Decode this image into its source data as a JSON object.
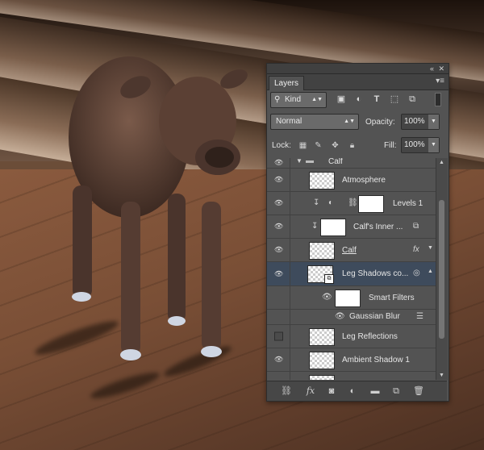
{
  "panel": {
    "tab_label": "Layers",
    "filter": {
      "mode": "Kind",
      "icons": [
        "image-filter-icon",
        "adjustment-filter-icon",
        "type-filter-icon",
        "shape-filter-icon",
        "smart-object-filter-icon"
      ]
    },
    "blend_mode": "Normal",
    "opacity_label": "Opacity:",
    "opacity_value": "100%",
    "lock_label": "Lock:",
    "fill_label": "Fill:",
    "fill_value": "100%"
  },
  "layers": [
    {
      "name": "Calf",
      "type": "group"
    },
    {
      "name": "Atmosphere",
      "type": "layer"
    },
    {
      "name": "Levels 1",
      "type": "adjustment"
    },
    {
      "name": "Calf's Inner ...",
      "type": "layer"
    },
    {
      "name": "Calf",
      "type": "layer",
      "fx": "fx"
    },
    {
      "name": "Leg Shadows co...",
      "type": "smart-object",
      "selected": true
    },
    {
      "name": "Smart Filters",
      "type": "filter-mask"
    },
    {
      "name": "Gaussian Blur",
      "type": "filter"
    },
    {
      "name": "Leg Reflections",
      "type": "layer",
      "visible": false
    },
    {
      "name": "Ambient Shadow 1",
      "type": "layer"
    }
  ],
  "bottom_icons": [
    "link-layers-icon",
    "fx-icon",
    "add-mask-icon",
    "adjustment-layer-icon",
    "new-group-icon",
    "new-layer-icon",
    "trash-icon"
  ],
  "colors": {
    "panel_bg": "#535353",
    "selected_row": "#3e4b5c"
  }
}
